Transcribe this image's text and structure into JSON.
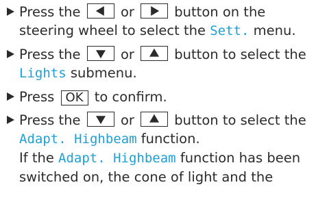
{
  "colors": {
    "text": "#2b2b2b",
    "display_text": "#1e9fd6"
  },
  "steps": [
    {
      "a1": "Press the",
      "or": "or",
      "a2": "button on the",
      "b1": "steering wheel to select the",
      "b2": "Sett.",
      "b3": "menu."
    },
    {
      "a1": "Press the",
      "or": "or",
      "a2": "button to select the",
      "b1": "Lights",
      "b2": "submenu."
    },
    {
      "a1": "Press",
      "key": "OK",
      "a2": "to confirm."
    },
    {
      "a1": "Press the",
      "or": "or",
      "a2": "button to select the",
      "b1": "Adapt. Highbeam",
      "b2": "function.",
      "c1": "If the",
      "c2": "Adapt. Highbeam",
      "c3": "function has been",
      "d1": "switched on, the cone of light and the"
    }
  ]
}
